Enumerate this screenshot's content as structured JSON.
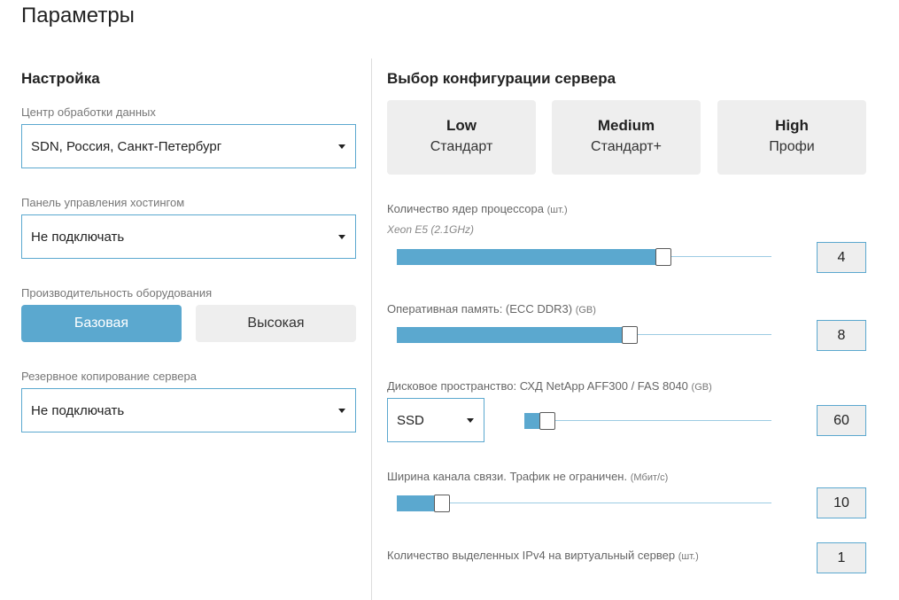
{
  "page": {
    "title": "Параметры"
  },
  "setup": {
    "title": "Настройка",
    "datacenter": {
      "label": "Центр обработки данных",
      "value": "SDN, Россия, Санкт-Петербург"
    },
    "hosting_panel": {
      "label": "Панель управления хостингом",
      "value": "Не подключать"
    },
    "performance": {
      "label": "Производительность оборудования",
      "options": [
        "Базовая",
        "Высокая"
      ],
      "selected": "Базовая"
    },
    "backup": {
      "label": "Резервное копирование сервера",
      "value": "Не подключать"
    }
  },
  "config": {
    "title": "Выбор конфигурации сервера",
    "presets": [
      {
        "name": "Low",
        "subtitle": "Стандарт"
      },
      {
        "name": "Medium",
        "subtitle": "Стандарт+"
      },
      {
        "name": "High",
        "subtitle": "Профи"
      }
    ],
    "cpu": {
      "label": "Количество ядер процессора",
      "unit": "(шт.)",
      "hint": "Xeon E5 (2.1GHz)",
      "value": "4",
      "fill_fraction": 0.69
    },
    "ram": {
      "label": "Оперативная память: (ECC DDR3)",
      "unit": "(GB)",
      "value": "8",
      "fill_fraction": 0.6
    },
    "disk": {
      "label": "Дисковое пространство: СХД NetApp AFF300 / FAS 8040",
      "unit": "(GB)",
      "type": "SSD",
      "value": "60",
      "fill_fraction": 0.06
    },
    "bandwidth": {
      "label": "Ширина канала связи. Трафик не ограничен.",
      "unit": "(Мбит/с)",
      "value": "10",
      "fill_fraction": 0.1
    },
    "ipv4": {
      "label": "Количество выделенных IPv4 на виртуальный сервер",
      "unit": "(шт.)",
      "value": "1"
    }
  },
  "colors": {
    "accent": "#5ba8cf",
    "card_bg": "#eeeeee",
    "divider": "#dcdcdc"
  }
}
